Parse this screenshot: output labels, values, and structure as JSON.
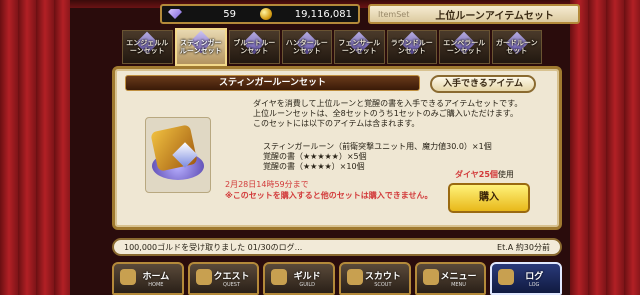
{
  "currencies": {
    "diamond": "59",
    "gold": "19,116,081"
  },
  "header": {
    "label": "ItemSet",
    "title": "上位ルーンアイテムセット"
  },
  "tabs": [
    {
      "label": "エンジェルルーンセット"
    },
    {
      "label": "スティンガールーンセット"
    },
    {
      "label": "ブルートルーンセット"
    },
    {
      "label": "ハンタールーンセット"
    },
    {
      "label": "フェンサールーンセット"
    },
    {
      "label": "ラウンドルーンセット"
    },
    {
      "label": "エンペラールーンセット"
    },
    {
      "label": "ガードルーンセット"
    }
  ],
  "panel": {
    "set_name": "スティンガールーンセット",
    "obtain_button": "入手できるアイテム",
    "desc": [
      "ダイヤを消費して上位ルーンと覚醒の書を入手できるアイテムセットです。",
      "上位ルーンセットは、全8セットのうち1セットのみご購入いただけます。",
      "このセットには以下のアイテムは含まれます。"
    ],
    "contents": [
      "スティンガールーン（前衛突撃ユニット用、魔力値30.0）×1個",
      "覚醒の書（★★★★★）×5個",
      "覚醒の書（★★★★）×10個"
    ],
    "deadline": "2月28日14時59分まで",
    "note": "※このセットを購入すると他のセットは購入できません。",
    "cost_dia": "ダイヤ25個",
    "cost_suffix": "使用",
    "buy_button": "購入"
  },
  "ticker": {
    "message": "100,000ゴルドを受け取りました 01/30のログ...",
    "author": "Et.A",
    "time": "約30分前"
  },
  "nav": [
    {
      "label": "ホーム",
      "sub": "HOME"
    },
    {
      "label": "クエスト",
      "sub": "QUEST"
    },
    {
      "label": "ギルド",
      "sub": "GUILD"
    },
    {
      "label": "スカウト",
      "sub": "SCOUT"
    },
    {
      "label": "メニュー",
      "sub": "MENU"
    },
    {
      "label": "ログ",
      "sub": "LOG"
    }
  ]
}
